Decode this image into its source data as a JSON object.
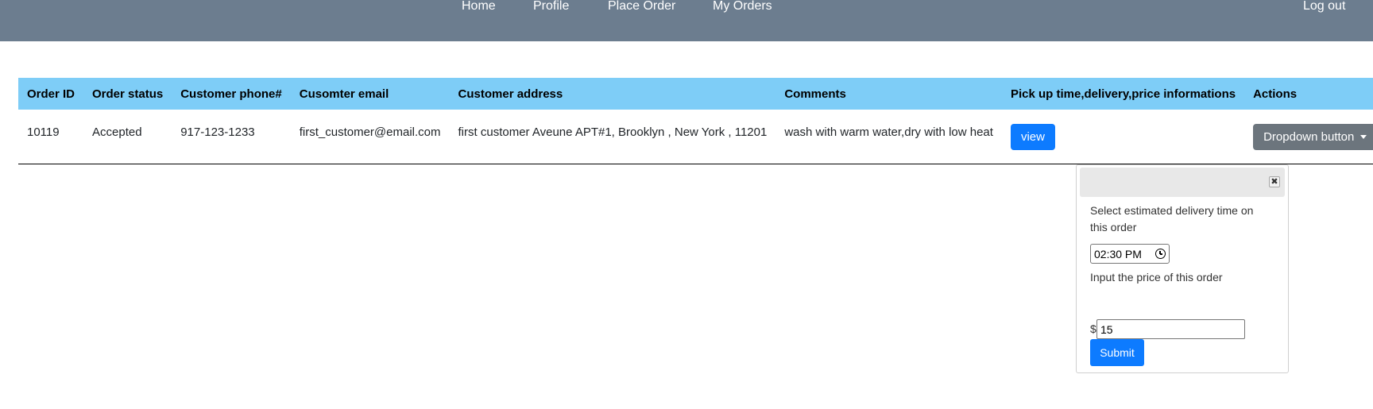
{
  "nav": {
    "items": [
      "Home",
      "Profile",
      "Place Order",
      "My Orders"
    ],
    "logout": "Log out"
  },
  "table": {
    "headers": [
      "Order ID",
      "Order status",
      "Customer phone#",
      "Cusomter email",
      "Customer address",
      "Comments",
      "Pick up time,delivery,price informations",
      "Actions"
    ],
    "rows": [
      {
        "order_id": "10119",
        "status": "Accepted",
        "phone": "917-123-1233",
        "email": "first_customer@email.com",
        "address": "first customer Aveune APT#1, Brooklyn , New York , 11201",
        "comments": "wash with warm water,dry with low heat",
        "view_label": "view",
        "actions_label": "Dropdown button"
      }
    ]
  },
  "popup": {
    "delivery_label": "Select estimated delivery time on this order",
    "time_value": "02:30  PM",
    "price_label": "Input the price of this order",
    "currency_symbol": "$",
    "price_value": "15",
    "submit_label": "Submit",
    "close_glyph": "✖"
  },
  "colors": {
    "navbar": "#6c7d8f",
    "table_header": "#7ecdf7",
    "primary_button": "#0d7bff",
    "secondary_button": "#6c757d"
  }
}
